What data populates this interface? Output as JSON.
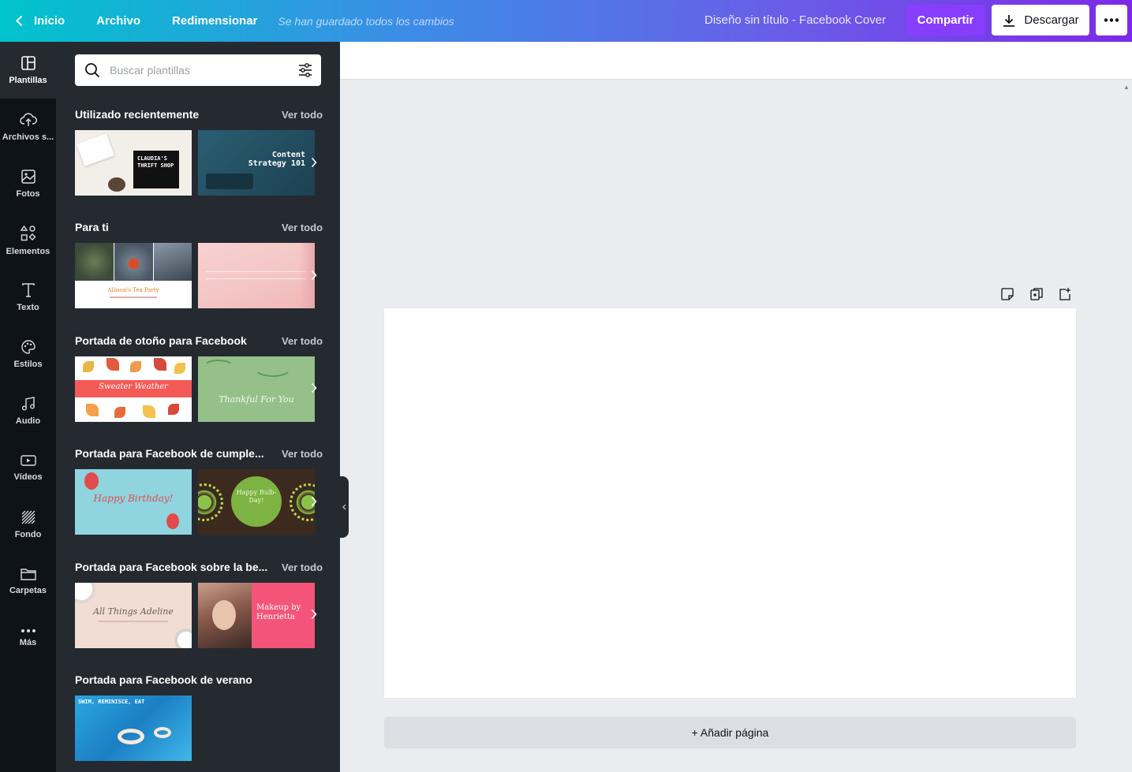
{
  "topbar": {
    "back_label": "Inicio",
    "file_label": "Archivo",
    "resize_label": "Redimensionar",
    "status": "Se han guardado todos los cambios",
    "doc_title": "Diseño sin título - Facebook Cover",
    "share_label": "Compartir",
    "download_label": "Descargar"
  },
  "rail": [
    {
      "label": "Plantillas",
      "icon": "templates-icon"
    },
    {
      "label": "Archivos s...",
      "icon": "upload-cloud-icon"
    },
    {
      "label": "Fotos",
      "icon": "photo-icon"
    },
    {
      "label": "Elementos",
      "icon": "shapes-icon"
    },
    {
      "label": "Texto",
      "icon": "text-icon"
    },
    {
      "label": "Estilos",
      "icon": "palette-icon"
    },
    {
      "label": "Audio",
      "icon": "music-note-icon"
    },
    {
      "label": "Vídeos",
      "icon": "video-icon"
    },
    {
      "label": "Fondo",
      "icon": "background-pattern-icon"
    },
    {
      "label": "Carpetas",
      "icon": "folder-icon"
    },
    {
      "label": "Más",
      "icon": "more-dots-icon"
    }
  ],
  "search": {
    "placeholder": "Buscar plantillas"
  },
  "sections": [
    {
      "title": "Utilizado recientemente",
      "more": "Ver todo",
      "thumbs": [
        {
          "text": "CLAUDIA'S THRIFT SHOP"
        },
        {
          "text": "Content Strategy 101"
        }
      ]
    },
    {
      "title": "Para ti",
      "more": "Ver todo",
      "thumbs": [
        {
          "text": "Allison's Tea Party"
        },
        {
          "text": ""
        }
      ]
    },
    {
      "title": "Portada de otoño para Facebook",
      "more": "Ver todo",
      "thumbs": [
        {
          "text": "Sweater Weather"
        },
        {
          "text": "Thankful For You"
        }
      ]
    },
    {
      "title": "Portada para Facebook de cumple...",
      "more": "Ver todo",
      "thumbs": [
        {
          "text": "Happy Birthday!"
        },
        {
          "text": "Happy Bulb-Day!"
        }
      ]
    },
    {
      "title": "Portada para Facebook sobre la be...",
      "more": "Ver todo",
      "thumbs": [
        {
          "text": "All Things Adeline"
        },
        {
          "text": "Makeup by Henrietta"
        }
      ]
    },
    {
      "title": "Portada para Facebook de verano",
      "more": "",
      "thumbs": [
        {
          "text": "SWIM, REMINISCE, EAT"
        }
      ]
    }
  ],
  "canvas": {
    "add_page_label": "+ Añadir página"
  },
  "colors": {
    "gradient_start": "#00c4cc",
    "gradient_end": "#7d2ae8",
    "rail_bg": "#0e1318",
    "panel_bg": "#252a31"
  }
}
